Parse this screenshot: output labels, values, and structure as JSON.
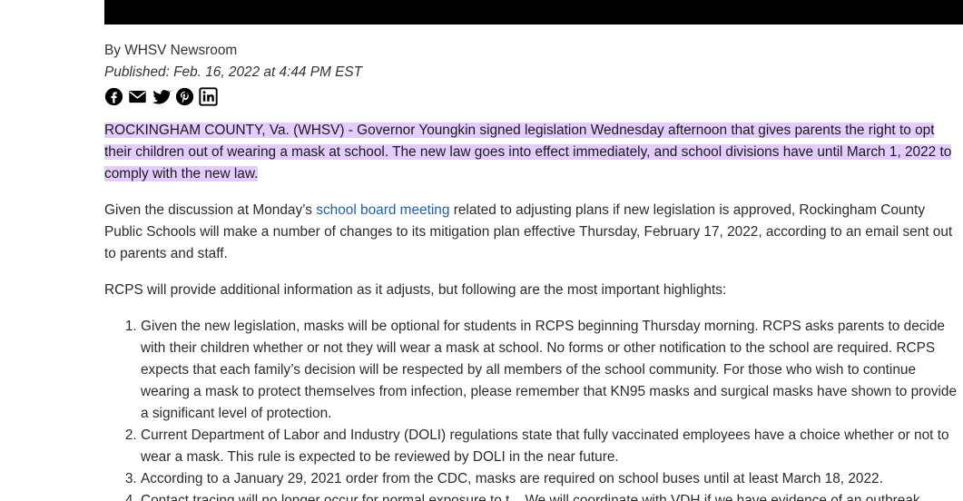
{
  "article": {
    "byline": "By WHSV Newsroom",
    "published": "Published: Feb. 16, 2022 at 4:44 PM EST",
    "share_icons": [
      "facebook-icon",
      "email-icon",
      "twitter-icon",
      "pinterest-icon",
      "linkedin-icon"
    ],
    "highlight_color": "#e5ccff",
    "link_color": "#1f5fa8",
    "lead": "ROCKINGHAM COUNTY, Va. (WHSV) - Governor Youngkin signed legislation Wednesday afternoon that gives parents the right to opt their children out of wearing a mask at school. The new law goes into effect immediately, and school divisions have until March 1, 2022 to comply with the new law.",
    "p2_before": "Given the discussion at Monday’s ",
    "p2_link": "school board meeting",
    "p2_after": " related to adjusting plans if new legislation is approved, Rockingham County Public Schools will make a number of changes to its mitigation plan effective Thursday, February 17, 2022, according to an email sent out to parents and staff.",
    "p3": "RCPS will provide additional information as it adjusts, but following are the most important highlights:",
    "highlights": [
      "Given the new legislation, masks will be optional for students in RCPS beginning Thursday morning. RCPS asks parents to decide with their children whether or not they will wear a mask at school. No forms or other notification to the school are required. RCPS expects that each family’s decision will be respected by all members of the school community. For those who wish to continue wearing a mask to protect themselves from infection, please remember that KN95 masks and surgical masks have shown to provide a significant level of protection.",
      "Current Department of Labor and Industry (DOLI) regulations state that fully vaccinated employees have a choice whether or not to wear a mask. This rule is expected to be reviewed by DOLI in the near future.",
      "According to a January 29, 2021 order from the CDC, masks are required on school buses until at least March 18, 2022.",
      "Contact tracing will no longer occur for normal exposure to t... We will coordinate with VDH if we have evidence of an outbreak"
    ]
  }
}
